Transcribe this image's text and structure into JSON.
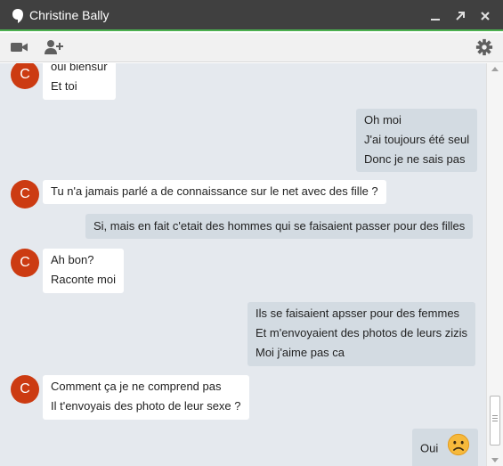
{
  "window": {
    "title": "Christine Bally",
    "controls": [
      "minimize-icon",
      "popout-icon",
      "close-icon"
    ],
    "accent_color": "#4caf50",
    "titlebar_color": "#404040"
  },
  "toolbar": {
    "buttons": [
      "video-icon",
      "add-person-icon",
      "gear-icon"
    ]
  },
  "contact": {
    "initial": "C",
    "avatar_color": "#cc3b12"
  },
  "messages": [
    {
      "from": "contact",
      "lines": [
        "oui biensur",
        "Et toi"
      ]
    },
    {
      "from": "me",
      "lines": [
        "Oh moi",
        "J'ai toujours été seul",
        "Donc je ne sais pas"
      ]
    },
    {
      "from": "contact",
      "lines": [
        "Tu n'a jamais parlé a  de connaissance sur le net avec des fille ?"
      ]
    },
    {
      "from": "me",
      "lines": [
        "Si, mais en fait c'etait des hommes qui se faisaient passer pour des filles"
      ]
    },
    {
      "from": "contact",
      "lines": [
        "Ah bon?",
        "Raconte moi"
      ]
    },
    {
      "from": "me",
      "lines": [
        "Ils se faisaient apsser pour des femmes",
        "Et m'envoyaient des photos de leurs zizis",
        "Moi j'aime pas ca"
      ]
    },
    {
      "from": "contact",
      "lines": [
        "Comment ça je ne comprend pas",
        "Il t'envoyais des photo de leur sexe ?"
      ]
    },
    {
      "from": "me",
      "lines": [
        "Oui"
      ],
      "emoji": "sad-face-icon"
    }
  ],
  "colors": {
    "incoming_bubble": "#ffffff",
    "outgoing_bubble": "#d3dbe2",
    "chat_background": "#e5e9ee"
  }
}
